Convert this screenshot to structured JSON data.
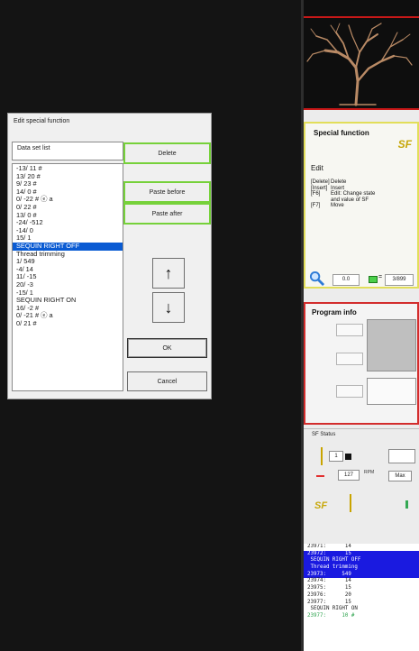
{
  "dialog": {
    "title": "Edit special function",
    "list_label": "Data set list",
    "items": [
      "-13/  11 #",
      "13/  20 #",
      "9/  23 #",
      "14/  0 #",
      "0/  -22 # ⓔ a",
      "0/  22 #",
      "13/  0 #",
      "-24/ -512",
      "-14/  0",
      "15/  1",
      "SEQUIN RIGHT OFF",
      "Thread trimming",
      "1/ 549",
      "-4/  14",
      "11/ -15",
      "20/  -3",
      "-15/  1",
      "SEQUIN RIGHT ON",
      "16/  -2 #",
      "0/ -21 # ⓔ a",
      "0/  21 #"
    ],
    "selected_index": 10,
    "buttons": {
      "delete": "Delete",
      "paste_before": "Paste before",
      "paste_after": "Paste after",
      "ok": "OK",
      "cancel": "Cancel"
    },
    "up_arrow": "↑",
    "down_arrow": "↓"
  },
  "special_function": {
    "title": "Special function",
    "logo": "SF",
    "edit_label": "Edit",
    "help": [
      {
        "key": "[Delete]",
        "desc": "Delete"
      },
      {
        "key": "[Insert]",
        "desc": "Insert"
      },
      {
        "key": "[F6]",
        "desc": "Edit: Change state"
      },
      {
        "key": "",
        "desc": "and value of SF"
      },
      {
        "key": "[F7]",
        "desc": "Move"
      }
    ]
  },
  "zoom": {
    "value": "0.0",
    "eq": "=",
    "count": "3/899"
  },
  "program_info": {
    "title": "Program info"
  },
  "sf_status": {
    "title": "SF Status",
    "counter": "1",
    "speed": "127",
    "rpm_label": "RPM",
    "max_label": "Max",
    "logo": "SF"
  },
  "console": {
    "lines": [
      {
        "text": "23971:      14",
        "hl": false
      },
      {
        "text": "23972:      15",
        "hl": true
      },
      {
        "text": " SEQUIN RIGHT OFF",
        "hl": true
      },
      {
        "text": " Thread trimming",
        "hl": true
      },
      {
        "text": "23973:     549",
        "hl": true
      },
      {
        "text": "23974:      14",
        "hl": false
      },
      {
        "text": "23975:      15",
        "hl": false
      },
      {
        "text": "23976:      20",
        "hl": false
      },
      {
        "text": "23977:      15",
        "hl": false
      },
      {
        "text": " SEQUIN RIGHT ON",
        "hl": false
      },
      {
        "text": "23977:     10 #",
        "hl": false
      }
    ]
  },
  "colors": {
    "selection": "#0a5bd3",
    "highlight_green": "#76d13a",
    "program_border": "#d32d2d",
    "sf_border": "#e2de5a",
    "console_highlight": "#1a1ae0"
  }
}
